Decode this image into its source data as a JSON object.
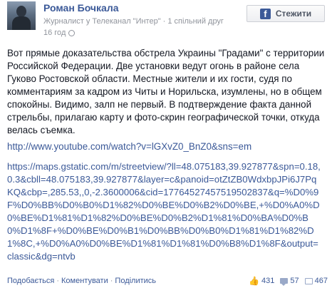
{
  "author": {
    "name": "Роман Бочкала",
    "subtitle": "Журналист у Телеканал \"Интер\" · 1 спільний друг",
    "time": "16 год"
  },
  "follow_button": {
    "label": "Стежити",
    "icon": "facebook-icon"
  },
  "post": {
    "text": "Вот прямые доказательства обстрела Украины \"Градами\" с территории Российской Федерации. Две установки ведут огонь в районе села Гуково Ростовской области. Местные жители и их гости, судя по комментариям за кадром из Читы и Норильска, изумлены, но в общем спокойны. Видимо, залп не первый. В подтверждение факта данной стрельбы, прилагаю карту и фото-скрин географической точки, откуда велась съемка.",
    "youtube_link": "http://www.youtube.com/watch?v=lGXvZ0_BnZ0&sns=em",
    "maps_link": "https://maps.gstatic.com/m/streetview/?ll=48.075183,39.927877&spn=0.18,0.3&cbll=48.075183,39.927877&layer=c&panoid=otZtZB0WdxbpJPi6J7PqKQ&cbp=,285.53,,0,-2.3600006&cid=17764527457519502837&q=%D0%9F%D0%BB%D0%B0%D1%82%D0%BE%D0%B2%D0%BE,+%D0%A0%D0%BE%D1%81%D1%82%D0%BE%D0%B2%D1%81%D0%BA%D0%B0%D1%8F+%D0%BE%D0%B1%D0%BB%D0%B0%D1%81%D1%82%D1%8C,+%D0%A0%D0%BE%D1%81%D1%81%D0%B8%D1%8F&output=classic&dg=ntvb"
  },
  "footer": {
    "like": "Подобається",
    "comment": "Коментувати",
    "share": "Поділитись",
    "separator": "·",
    "likes_count": "431",
    "comments_count": "57",
    "shares_count": "467"
  },
  "colors": {
    "link": "#3b5998",
    "meta": "#90949c",
    "text": "#141823"
  }
}
